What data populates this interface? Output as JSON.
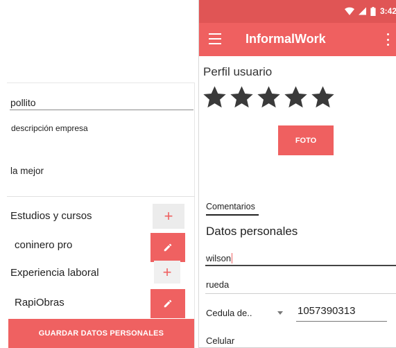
{
  "left_form": {
    "name_value": "pollito",
    "description_placeholder": "descripción empresa",
    "description_value": "la mejor",
    "studies_label": "Estudios y cursos",
    "add_symbol": "+",
    "course_item": "coninero pro",
    "experience_label": "Experiencia laboral",
    "company_item": "RapiObras",
    "save_button_label": "GUARDAR DATOS PERSONALES"
  },
  "phone": {
    "status_bar": {
      "time": "3:42",
      "icons": [
        "wifi-icon",
        "signal-icon",
        "battery-icon"
      ]
    },
    "app_bar": {
      "title": "InformalWork",
      "menu_icon": "menu-icon",
      "overflow_icon": "more-vert-icon"
    },
    "profile": {
      "title": "Perfil usuario",
      "rating_stars": 5,
      "photo_button_label": "FOTO"
    },
    "comments_tab": "Comentarios",
    "personal_data": {
      "title": "Datos personales",
      "first_name": "wilson",
      "last_name": "rueda",
      "document_type": "Cedula de..",
      "document_number": "1057390313",
      "phone_label": "Celular"
    }
  },
  "colors": {
    "accent": "#ef6060",
    "status_bar": "#e05555",
    "star": "#3a3a3a"
  }
}
